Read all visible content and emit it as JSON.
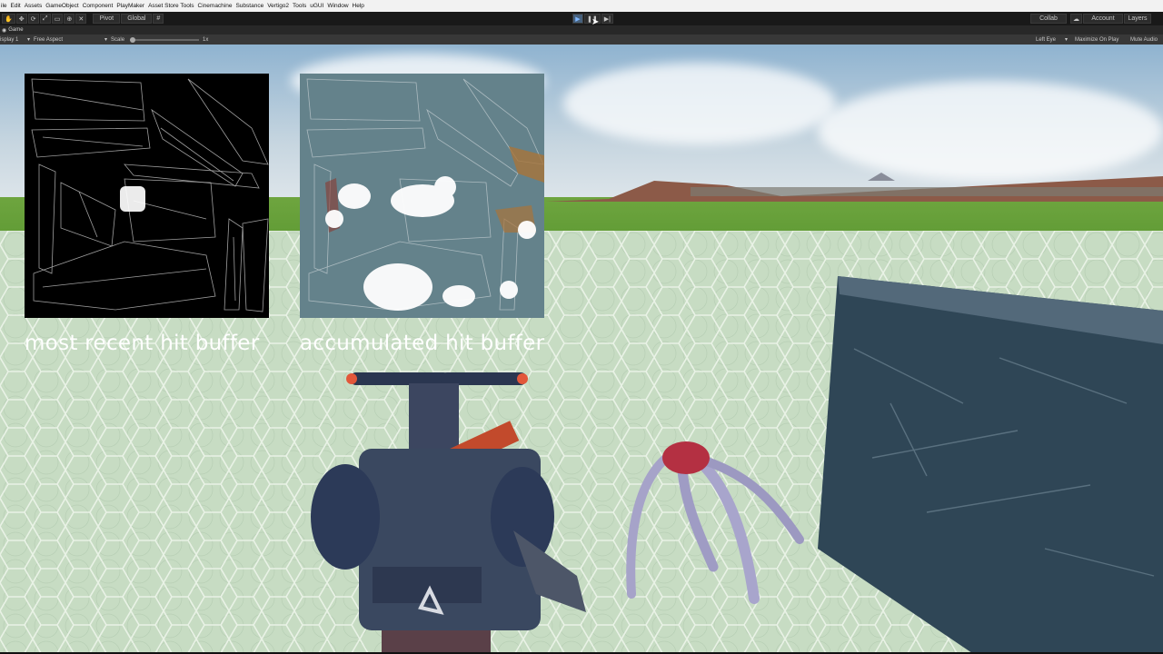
{
  "menu": [
    "ile",
    "Edit",
    "Assets",
    "GameObject",
    "Component",
    "PlayMaker",
    "Asset Store Tools",
    "Cinemachine",
    "Substance",
    "Vertigo2",
    "Tools",
    "uGUI",
    "Window",
    "Help"
  ],
  "toolbar": {
    "pivot": "Pivot",
    "global": "Global",
    "collab": "Collab",
    "account": "Account",
    "layers": "Layers"
  },
  "tab": {
    "game": "Game"
  },
  "gamebar": {
    "display": "isplay 1",
    "aspect": "Free Aspect",
    "scale_label": "Scale",
    "scale_value": "1x",
    "eye": "Left Eye",
    "maximize": "Maximize On Play",
    "mute": "Mute Audio"
  },
  "captions": {
    "recent": "most recent hit buffer",
    "accumulated": "accumulated hit buffer"
  },
  "colors": {
    "play_active": "#46607c",
    "floor": "#c7dcc3",
    "grass": "#6ea53f"
  }
}
